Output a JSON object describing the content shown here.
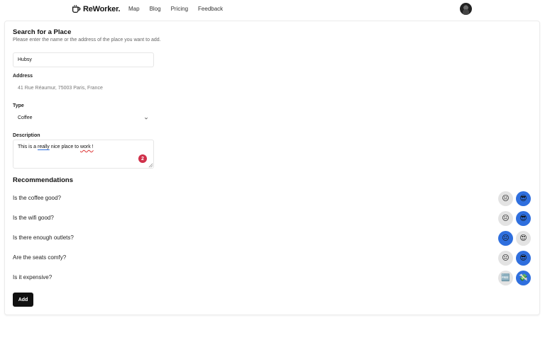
{
  "nav": {
    "brand": "ReWorker.",
    "links": [
      "Map",
      "Blog",
      "Pricing",
      "Feedback"
    ]
  },
  "form": {
    "title": "Search for a Place",
    "subtitle": "Please enter the name or the address of the place you want to add.",
    "name_value": "Hubsy",
    "address_label": "Address",
    "address_value": "41 Rue Réaumur, 75003 Paris, France",
    "type_label": "Type",
    "type_value": "Coffee",
    "description_label": "Description",
    "description": {
      "part1": "This is a ",
      "part2": "really",
      "part3": " nice place to ",
      "part4": "work !"
    },
    "grammar_count": "2"
  },
  "recommendations": {
    "title": "Recommendations",
    "items": [
      {
        "question": "Is the coffee good?",
        "options": [
          {
            "emoji": "😐",
            "selected": false
          },
          {
            "emoji": "😎",
            "selected": true
          }
        ]
      },
      {
        "question": "Is the wifi good?",
        "options": [
          {
            "emoji": "😐",
            "selected": false
          },
          {
            "emoji": "😎",
            "selected": true
          }
        ]
      },
      {
        "question": "Is there enough outlets?",
        "options": [
          {
            "emoji": "😐",
            "selected": true
          },
          {
            "emoji": "😍",
            "selected": false
          }
        ]
      },
      {
        "question": "Are the seats comfy?",
        "options": [
          {
            "emoji": "😐",
            "selected": false
          },
          {
            "emoji": "😎",
            "selected": true
          }
        ]
      },
      {
        "question": "Is it expensive?",
        "options": [
          {
            "emoji": "🆓",
            "selected": false
          },
          {
            "emoji": "💸",
            "selected": true
          }
        ]
      }
    ]
  },
  "add_label": "Add",
  "colors": {
    "accent": "#2f6fde",
    "button": "#111111",
    "badge": "#d0304a"
  }
}
